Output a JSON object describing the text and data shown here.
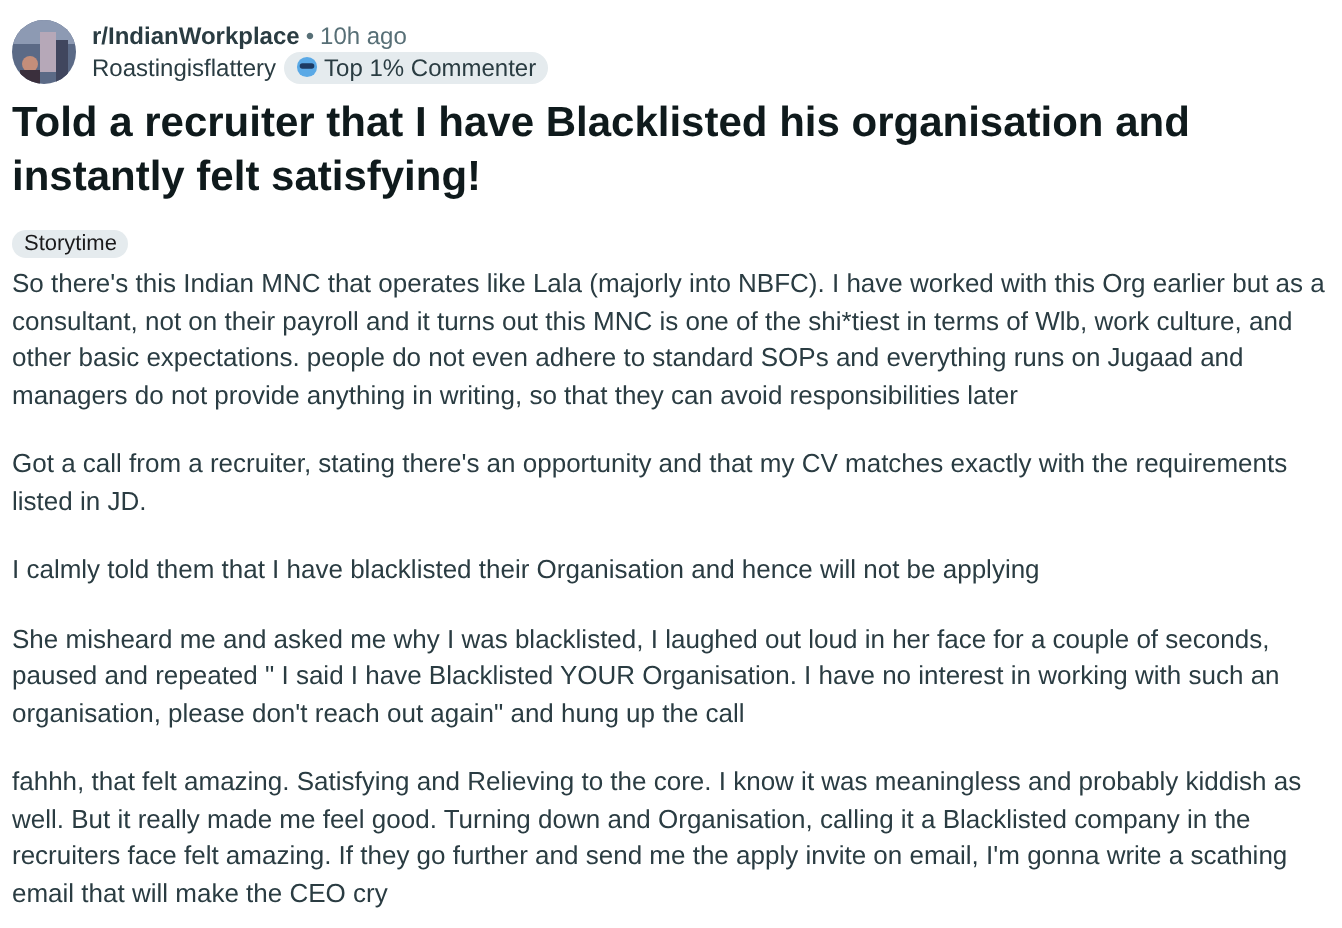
{
  "post": {
    "subreddit": "r/IndianWorkplace",
    "separator": "•",
    "time": "10h ago",
    "author": "Roastingisflattery",
    "badge": "Top 1% Commenter",
    "title": "Told a recruiter that I have Blacklisted his organisation and instantly felt satisfying!",
    "flair": "Storytime",
    "paragraphs": [
      "So there's this Indian MNC that operates like Lala (majorly into NBFC). I have worked with this Org earlier but as a consultant, not on their payroll and it turns out this MNC is one of the shi*tiest in terms of Wlb, work culture, and other basic expectations. people do not even adhere to standard SOPs and everything runs on Jugaad and managers do not provide anything in writing, so that they can avoid responsibilities later",
      "Got a call from a recruiter, stating there's an opportunity and that my CV matches exactly with the requirements listed in JD.",
      "I calmly told them that I have blacklisted their Organisation and hence will not be applying",
      "She misheard me and asked me why I was blacklisted, I laughed out loud in her face for a couple of seconds, paused and repeated \" I said I have Blacklisted YOUR Organisation. I have no interest in working with such an organisation, please don't reach out again\" and hung up the call",
      "fahhh, that felt amazing. Satisfying and Relieving to the core. I know it was meaningless and probably kiddish as well. But it really made me feel good. Turning down and Organisation, calling it a Blacklisted company in the recruiters face felt amazing. If they go further and send me the apply invite on email, I'm gonna write a scathing email that will make the CEO cry"
    ]
  }
}
